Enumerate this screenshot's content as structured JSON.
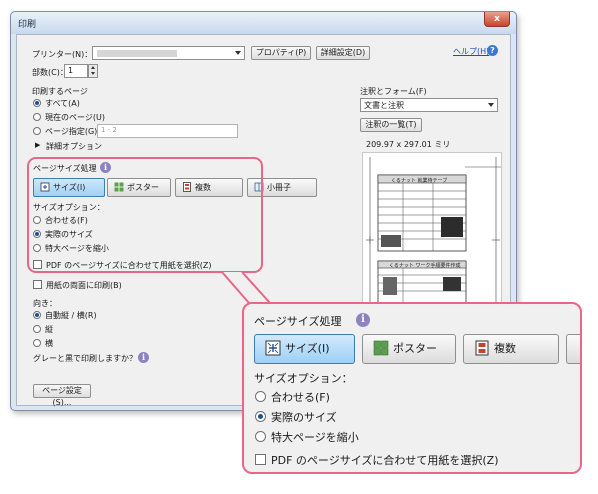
{
  "window": {
    "title": "印刷",
    "close_label": "x"
  },
  "printer": {
    "label": "プリンター(N)：",
    "properties_button": "プロパティ(P)",
    "advanced_button": "詳細設定(D)",
    "help_link": "ヘルプ(H)"
  },
  "copies": {
    "label": "部数(C)：",
    "value": "1"
  },
  "pages_to_print": {
    "heading": "印刷するページ",
    "options": [
      {
        "label": "すべて(A)",
        "selected": true
      },
      {
        "label": "現在のページ(U)",
        "selected": false
      },
      {
        "label": "ページ指定(G)",
        "selected": false
      }
    ],
    "range_placeholder": "1 - 2",
    "more_options": "詳細オプション"
  },
  "page_sizing": {
    "heading": "ページサイズ処理",
    "buttons": [
      {
        "label": "サイズ(I)",
        "active": true
      },
      {
        "label": "ポスター",
        "active": false
      },
      {
        "label": "複数",
        "active": false
      },
      {
        "label": "小冊子",
        "active": false
      }
    ],
    "size_options_heading": "サイズオプション：",
    "size_options": [
      {
        "label": "合わせる(F)",
        "selected": false
      },
      {
        "label": "実際のサイズ",
        "selected": true
      },
      {
        "label": "特大ページを縮小",
        "selected": false
      }
    ],
    "choose_paper_label": "PDF のページサイズに合わせて用紙を選択(Z)"
  },
  "duplex": {
    "label": "用紙の両面に印刷(B)"
  },
  "orientation": {
    "heading": "向き：",
    "options": [
      {
        "label": "自動縦 / 横(R)",
        "selected": true
      },
      {
        "label": "縦",
        "selected": false
      },
      {
        "label": "横",
        "selected": false
      }
    ]
  },
  "grayscale_label": "グレーと黒で印刷しますか？",
  "page_setup_button": "ページ設定(S)...",
  "comments_forms": {
    "heading": "注釈とフォーム(F)",
    "selected": "文書と注釈",
    "summarize_button": "注釈の一覧(T)"
  },
  "preview": {
    "size_text": "209.97 x 297.01 ミリ",
    "doc_heading_1": "くるナット 就業待テーブ",
    "doc_heading_2": "くるナット ワーク手順要件作成"
  },
  "zoom": {
    "heading": "ページサイズ処理",
    "buttons": [
      {
        "label": "サイズ(I)",
        "active": true
      },
      {
        "label": "ポスター",
        "active": false
      },
      {
        "label": "複数",
        "active": false
      }
    ],
    "size_options_heading": "サイズオプション：",
    "size_options": [
      {
        "label": "合わせる(F)",
        "selected": false
      },
      {
        "label": "実際のサイズ",
        "selected": true
      },
      {
        "label": "特大ページを縮小",
        "selected": false
      }
    ],
    "choose_paper_label": "PDF のページサイズに合わせて用紙を選択(Z)"
  },
  "colors": {
    "highlight": "#e96686",
    "active_button": "#9fd0f5",
    "window_frame": "#dbe6f3"
  }
}
